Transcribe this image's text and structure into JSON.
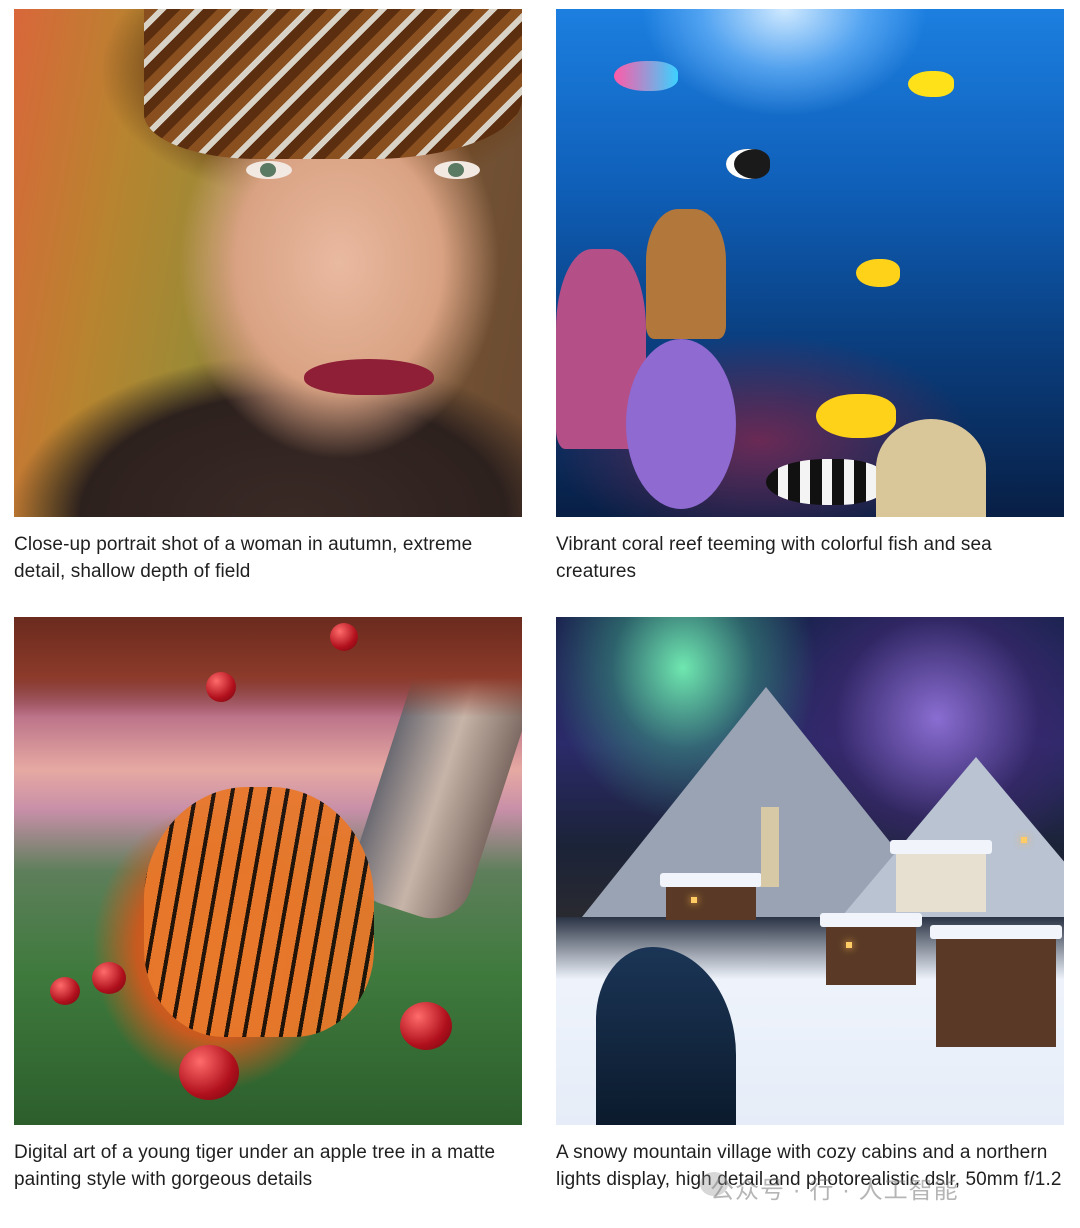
{
  "gallery": {
    "items": [
      {
        "caption": "Close-up portrait shot of a woman in autumn, extreme detail, shallow depth of field"
      },
      {
        "caption": "Vibrant coral reef teeming with colorful fish and sea creatures"
      },
      {
        "caption": "Digital art of a young tiger under an apple tree in a matte painting style with gorgeous details"
      },
      {
        "caption": "A snowy mountain village with cozy cabins and a northern lights display, high detail and photorealistic dslr, 50mm f/1.2"
      }
    ]
  },
  "watermark": {
    "text": "公众号 · 行 · 人工智能"
  }
}
